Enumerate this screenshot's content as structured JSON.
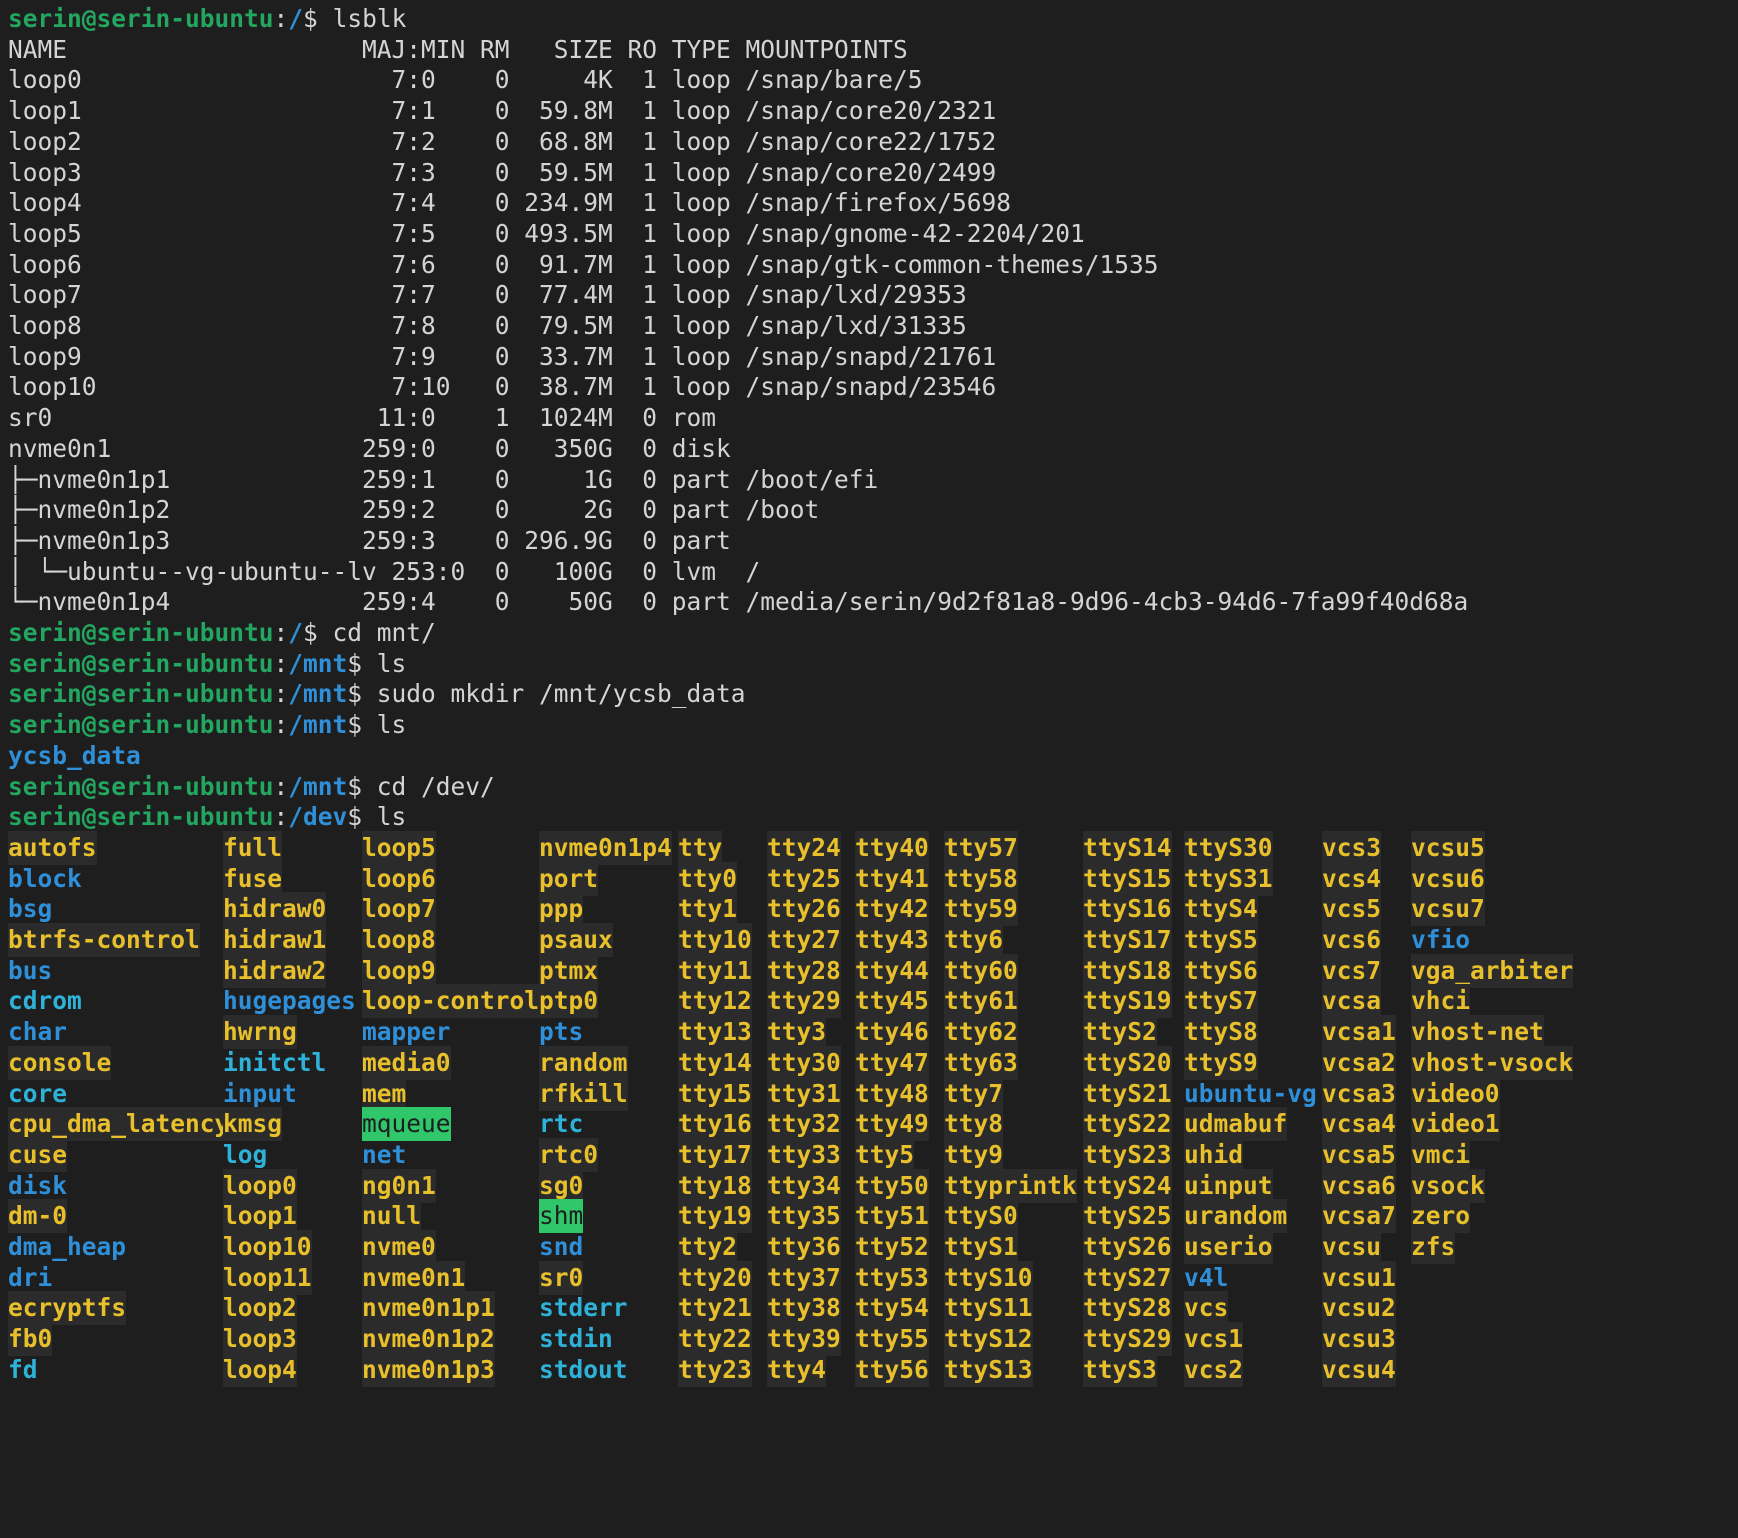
{
  "prompt": {
    "user_host": "serin@serin-ubuntu",
    "sep": ":"
  },
  "lsblk": {
    "command": "lsblk",
    "header": "NAME                    MAJ:MIN RM   SIZE RO TYPE MOUNTPOINTS",
    "rows": [
      "loop0                     7:0    0     4K  1 loop /snap/bare/5",
      "loop1                     7:1    0  59.8M  1 loop /snap/core20/2321",
      "loop2                     7:2    0  68.8M  1 loop /snap/core22/1752",
      "loop3                     7:3    0  59.5M  1 loop /snap/core20/2499",
      "loop4                     7:4    0 234.9M  1 loop /snap/firefox/5698",
      "loop5                     7:5    0 493.5M  1 loop /snap/gnome-42-2204/201",
      "loop6                     7:6    0  91.7M  1 loop /snap/gtk-common-themes/1535",
      "loop7                     7:7    0  77.4M  1 loop /snap/lxd/29353",
      "loop8                     7:8    0  79.5M  1 loop /snap/lxd/31335",
      "loop9                     7:9    0  33.7M  1 loop /snap/snapd/21761",
      "loop10                    7:10   0  38.7M  1 loop /snap/snapd/23546",
      "sr0                      11:0    1  1024M  0 rom",
      "nvme0n1                 259:0    0   350G  0 disk",
      "├─nvme0n1p1             259:1    0     1G  0 part /boot/efi",
      "├─nvme0n1p2             259:2    0     2G  0 part /boot",
      "├─nvme0n1p3             259:3    0 296.9G  0 part",
      "│ └─ubuntu--vg-ubuntu--lv 253:0  0   100G  0 lvm  /",
      "└─nvme0n1p4             259:4    0    50G  0 part /media/serin/9d2f81a8-9d96-4cb3-94d6-7fa99f40d68a"
    ]
  },
  "commands": [
    {
      "path": "/",
      "cmd": "cd mnt/"
    },
    {
      "path": "/mnt",
      "cmd": "ls"
    },
    {
      "path": "/mnt",
      "cmd": "sudo mkdir /mnt/ycsb_data"
    },
    {
      "path": "/mnt",
      "cmd": "ls"
    },
    {
      "path": "/mnt",
      "cmd": "cd /dev/"
    },
    {
      "path": "/dev",
      "cmd": "ls"
    }
  ],
  "mnt_ls_output": "ycsb_data",
  "dev_ls": {
    "columns": [
      [
        {
          "n": "autofs",
          "t": "dev"
        },
        {
          "n": "block",
          "t": "dir"
        },
        {
          "n": "bsg",
          "t": "dir"
        },
        {
          "n": "btrfs-control",
          "t": "dev"
        },
        {
          "n": "bus",
          "t": "dir"
        },
        {
          "n": "cdrom",
          "t": "link"
        },
        {
          "n": "char",
          "t": "dir"
        },
        {
          "n": "console",
          "t": "dev"
        },
        {
          "n": "core",
          "t": "link"
        },
        {
          "n": "cpu_dma_latency",
          "t": "dev"
        },
        {
          "n": "cuse",
          "t": "dev"
        },
        {
          "n": "disk",
          "t": "dir"
        },
        {
          "n": "dm-0",
          "t": "dev"
        },
        {
          "n": "dma_heap",
          "t": "dir"
        },
        {
          "n": "dri",
          "t": "dir"
        },
        {
          "n": "ecryptfs",
          "t": "dev"
        },
        {
          "n": "fb0",
          "t": "dev"
        },
        {
          "n": "fd",
          "t": "link"
        }
      ],
      [
        {
          "n": "full",
          "t": "dev"
        },
        {
          "n": "fuse",
          "t": "dev"
        },
        {
          "n": "hidraw0",
          "t": "dev"
        },
        {
          "n": "hidraw1",
          "t": "dev"
        },
        {
          "n": "hidraw2",
          "t": "dev"
        },
        {
          "n": "hugepages",
          "t": "dir"
        },
        {
          "n": "hwrng",
          "t": "dev"
        },
        {
          "n": "initctl",
          "t": "link"
        },
        {
          "n": "input",
          "t": "dir"
        },
        {
          "n": "kmsg",
          "t": "dev"
        },
        {
          "n": "log",
          "t": "link"
        },
        {
          "n": "loop0",
          "t": "dev"
        },
        {
          "n": "loop1",
          "t": "dev"
        },
        {
          "n": "loop10",
          "t": "dev"
        },
        {
          "n": "loop11",
          "t": "dev"
        },
        {
          "n": "loop2",
          "t": "dev"
        },
        {
          "n": "loop3",
          "t": "dev"
        },
        {
          "n": "loop4",
          "t": "dev"
        }
      ],
      [
        {
          "n": "loop5",
          "t": "dev"
        },
        {
          "n": "loop6",
          "t": "dev"
        },
        {
          "n": "loop7",
          "t": "dev"
        },
        {
          "n": "loop8",
          "t": "dev"
        },
        {
          "n": "loop9",
          "t": "dev"
        },
        {
          "n": "loop-control",
          "t": "dev"
        },
        {
          "n": "mapper",
          "t": "dir"
        },
        {
          "n": "media0",
          "t": "dev"
        },
        {
          "n": "mem",
          "t": "dev"
        },
        {
          "n": "mqueue",
          "t": "sticky"
        },
        {
          "n": "net",
          "t": "dir"
        },
        {
          "n": "ng0n1",
          "t": "dev"
        },
        {
          "n": "null",
          "t": "dev"
        },
        {
          "n": "nvme0",
          "t": "dev"
        },
        {
          "n": "nvme0n1",
          "t": "dev"
        },
        {
          "n": "nvme0n1p1",
          "t": "dev"
        },
        {
          "n": "nvme0n1p2",
          "t": "dev"
        },
        {
          "n": "nvme0n1p3",
          "t": "dev"
        }
      ],
      [
        {
          "n": "nvme0n1p4",
          "t": "dev"
        },
        {
          "n": "port",
          "t": "dev"
        },
        {
          "n": "ppp",
          "t": "dev"
        },
        {
          "n": "psaux",
          "t": "dev"
        },
        {
          "n": "ptmx",
          "t": "dev"
        },
        {
          "n": "ptp0",
          "t": "dev"
        },
        {
          "n": "pts",
          "t": "dir"
        },
        {
          "n": "random",
          "t": "dev"
        },
        {
          "n": "rfkill",
          "t": "dev"
        },
        {
          "n": "rtc",
          "t": "link"
        },
        {
          "n": "rtc0",
          "t": "dev"
        },
        {
          "n": "sg0",
          "t": "dev"
        },
        {
          "n": "shm",
          "t": "sticky"
        },
        {
          "n": "snd",
          "t": "dir"
        },
        {
          "n": "sr0",
          "t": "dev"
        },
        {
          "n": "stderr",
          "t": "link"
        },
        {
          "n": "stdin",
          "t": "link"
        },
        {
          "n": "stdout",
          "t": "link"
        }
      ],
      [
        {
          "n": "tty",
          "t": "dev"
        },
        {
          "n": "tty0",
          "t": "dev"
        },
        {
          "n": "tty1",
          "t": "dev"
        },
        {
          "n": "tty10",
          "t": "dev"
        },
        {
          "n": "tty11",
          "t": "dev"
        },
        {
          "n": "tty12",
          "t": "dev"
        },
        {
          "n": "tty13",
          "t": "dev"
        },
        {
          "n": "tty14",
          "t": "dev"
        },
        {
          "n": "tty15",
          "t": "dev"
        },
        {
          "n": "tty16",
          "t": "dev"
        },
        {
          "n": "tty17",
          "t": "dev"
        },
        {
          "n": "tty18",
          "t": "dev"
        },
        {
          "n": "tty19",
          "t": "dev"
        },
        {
          "n": "tty2",
          "t": "dev"
        },
        {
          "n": "tty20",
          "t": "dev"
        },
        {
          "n": "tty21",
          "t": "dev"
        },
        {
          "n": "tty22",
          "t": "dev"
        },
        {
          "n": "tty23",
          "t": "dev"
        }
      ],
      [
        {
          "n": "tty24",
          "t": "dev"
        },
        {
          "n": "tty25",
          "t": "dev"
        },
        {
          "n": "tty26",
          "t": "dev"
        },
        {
          "n": "tty27",
          "t": "dev"
        },
        {
          "n": "tty28",
          "t": "dev"
        },
        {
          "n": "tty29",
          "t": "dev"
        },
        {
          "n": "tty3",
          "t": "dev"
        },
        {
          "n": "tty30",
          "t": "dev"
        },
        {
          "n": "tty31",
          "t": "dev"
        },
        {
          "n": "tty32",
          "t": "dev"
        },
        {
          "n": "tty33",
          "t": "dev"
        },
        {
          "n": "tty34",
          "t": "dev"
        },
        {
          "n": "tty35",
          "t": "dev"
        },
        {
          "n": "tty36",
          "t": "dev"
        },
        {
          "n": "tty37",
          "t": "dev"
        },
        {
          "n": "tty38",
          "t": "dev"
        },
        {
          "n": "tty39",
          "t": "dev"
        },
        {
          "n": "tty4",
          "t": "dev"
        }
      ],
      [
        {
          "n": "tty40",
          "t": "dev"
        },
        {
          "n": "tty41",
          "t": "dev"
        },
        {
          "n": "tty42",
          "t": "dev"
        },
        {
          "n": "tty43",
          "t": "dev"
        },
        {
          "n": "tty44",
          "t": "dev"
        },
        {
          "n": "tty45",
          "t": "dev"
        },
        {
          "n": "tty46",
          "t": "dev"
        },
        {
          "n": "tty47",
          "t": "dev"
        },
        {
          "n": "tty48",
          "t": "dev"
        },
        {
          "n": "tty49",
          "t": "dev"
        },
        {
          "n": "tty5",
          "t": "dev"
        },
        {
          "n": "tty50",
          "t": "dev"
        },
        {
          "n": "tty51",
          "t": "dev"
        },
        {
          "n": "tty52",
          "t": "dev"
        },
        {
          "n": "tty53",
          "t": "dev"
        },
        {
          "n": "tty54",
          "t": "dev"
        },
        {
          "n": "tty55",
          "t": "dev"
        },
        {
          "n": "tty56",
          "t": "dev"
        }
      ],
      [
        {
          "n": "tty57",
          "t": "dev"
        },
        {
          "n": "tty58",
          "t": "dev"
        },
        {
          "n": "tty59",
          "t": "dev"
        },
        {
          "n": "tty6",
          "t": "dev"
        },
        {
          "n": "tty60",
          "t": "dev"
        },
        {
          "n": "tty61",
          "t": "dev"
        },
        {
          "n": "tty62",
          "t": "dev"
        },
        {
          "n": "tty63",
          "t": "dev"
        },
        {
          "n": "tty7",
          "t": "dev"
        },
        {
          "n": "tty8",
          "t": "dev"
        },
        {
          "n": "tty9",
          "t": "dev"
        },
        {
          "n": "ttyprintk",
          "t": "dev"
        },
        {
          "n": "ttyS0",
          "t": "dev"
        },
        {
          "n": "ttyS1",
          "t": "dev"
        },
        {
          "n": "ttyS10",
          "t": "dev"
        },
        {
          "n": "ttyS11",
          "t": "dev"
        },
        {
          "n": "ttyS12",
          "t": "dev"
        },
        {
          "n": "ttyS13",
          "t": "dev"
        }
      ],
      [
        {
          "n": "ttyS14",
          "t": "dev"
        },
        {
          "n": "ttyS15",
          "t": "dev"
        },
        {
          "n": "ttyS16",
          "t": "dev"
        },
        {
          "n": "ttyS17",
          "t": "dev"
        },
        {
          "n": "ttyS18",
          "t": "dev"
        },
        {
          "n": "ttyS19",
          "t": "dev"
        },
        {
          "n": "ttyS2",
          "t": "dev"
        },
        {
          "n": "ttyS20",
          "t": "dev"
        },
        {
          "n": "ttyS21",
          "t": "dev"
        },
        {
          "n": "ttyS22",
          "t": "dev"
        },
        {
          "n": "ttyS23",
          "t": "dev"
        },
        {
          "n": "ttyS24",
          "t": "dev"
        },
        {
          "n": "ttyS25",
          "t": "dev"
        },
        {
          "n": "ttyS26",
          "t": "dev"
        },
        {
          "n": "ttyS27",
          "t": "dev"
        },
        {
          "n": "ttyS28",
          "t": "dev"
        },
        {
          "n": "ttyS29",
          "t": "dev"
        },
        {
          "n": "ttyS3",
          "t": "dev"
        }
      ],
      [
        {
          "n": "ttyS30",
          "t": "dev"
        },
        {
          "n": "ttyS31",
          "t": "dev"
        },
        {
          "n": "ttyS4",
          "t": "dev"
        },
        {
          "n": "ttyS5",
          "t": "dev"
        },
        {
          "n": "ttyS6",
          "t": "dev"
        },
        {
          "n": "ttyS7",
          "t": "dev"
        },
        {
          "n": "ttyS8",
          "t": "dev"
        },
        {
          "n": "ttyS9",
          "t": "dev"
        },
        {
          "n": "ubuntu-vg",
          "t": "dir"
        },
        {
          "n": "udmabuf",
          "t": "dev"
        },
        {
          "n": "uhid",
          "t": "dev"
        },
        {
          "n": "uinput",
          "t": "dev"
        },
        {
          "n": "urandom",
          "t": "dev"
        },
        {
          "n": "userio",
          "t": "dev"
        },
        {
          "n": "v4l",
          "t": "dir"
        },
        {
          "n": "vcs",
          "t": "dev"
        },
        {
          "n": "vcs1",
          "t": "dev"
        },
        {
          "n": "vcs2",
          "t": "dev"
        }
      ],
      [
        {
          "n": "vcs3",
          "t": "dev"
        },
        {
          "n": "vcs4",
          "t": "dev"
        },
        {
          "n": "vcs5",
          "t": "dev"
        },
        {
          "n": "vcs6",
          "t": "dev"
        },
        {
          "n": "vcs7",
          "t": "dev"
        },
        {
          "n": "vcsa",
          "t": "dev"
        },
        {
          "n": "vcsa1",
          "t": "dev"
        },
        {
          "n": "vcsa2",
          "t": "dev"
        },
        {
          "n": "vcsa3",
          "t": "dev"
        },
        {
          "n": "vcsa4",
          "t": "dev"
        },
        {
          "n": "vcsa5",
          "t": "dev"
        },
        {
          "n": "vcsa6",
          "t": "dev"
        },
        {
          "n": "vcsa7",
          "t": "dev"
        },
        {
          "n": "vcsu",
          "t": "dev"
        },
        {
          "n": "vcsu1",
          "t": "dev"
        },
        {
          "n": "vcsu2",
          "t": "dev"
        },
        {
          "n": "vcsu3",
          "t": "dev"
        },
        {
          "n": "vcsu4",
          "t": "dev"
        }
      ],
      [
        {
          "n": "vcsu5",
          "t": "dev"
        },
        {
          "n": "vcsu6",
          "t": "dev"
        },
        {
          "n": "vcsu7",
          "t": "dev"
        },
        {
          "n": "vfio",
          "t": "dir"
        },
        {
          "n": "vga_arbiter",
          "t": "dev"
        },
        {
          "n": "vhci",
          "t": "dev"
        },
        {
          "n": "vhost-net",
          "t": "dev"
        },
        {
          "n": "vhost-vsock",
          "t": "dev"
        },
        {
          "n": "video0",
          "t": "dev"
        },
        {
          "n": "video1",
          "t": "dev"
        },
        {
          "n": "vmci",
          "t": "dev"
        },
        {
          "n": "vsock",
          "t": "dev"
        },
        {
          "n": "zero",
          "t": "dev"
        },
        {
          "n": "zfs",
          "t": "dev"
        }
      ]
    ]
  }
}
